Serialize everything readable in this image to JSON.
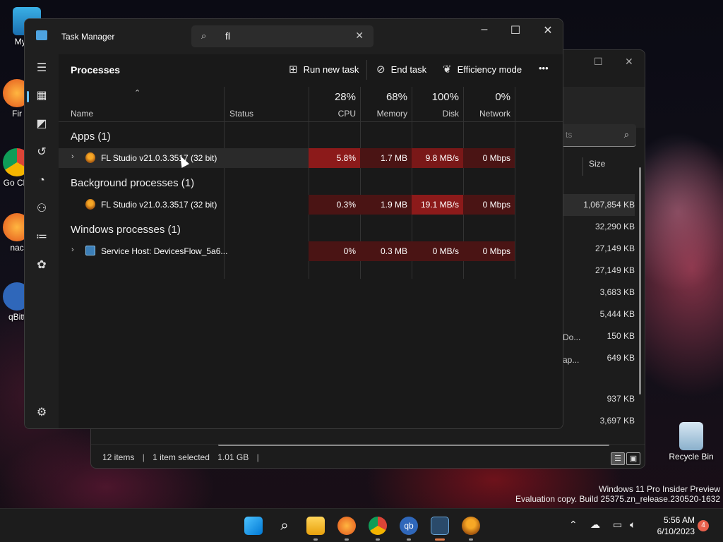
{
  "desktop": {
    "icons": [
      {
        "label": "My Co"
      },
      {
        "label": "Fir"
      },
      {
        "label": "Go Chr"
      },
      {
        "label": "nac"
      },
      {
        "label": "qBitt"
      },
      {
        "label": "Recycle Bin"
      }
    ]
  },
  "explorer": {
    "search_placeholder": "ts",
    "size_header": "Size",
    "sizes": [
      "1,067,854 KB",
      "32,290 KB",
      "27,149 KB",
      "27,149 KB",
      "3,683 KB",
      "5,444 KB",
      "150 KB",
      "649 KB",
      "",
      "937 KB",
      "3,697 KB"
    ],
    "fragments": [
      "Do...",
      "ap..."
    ],
    "status": {
      "items": "12 items",
      "selected": "1 item selected",
      "size": "1.01 GB"
    }
  },
  "task_manager": {
    "title": "Task Manager",
    "search_value": "fl",
    "page_heading": "Processes",
    "toolbar": {
      "run_new_task": "Run new task",
      "end_task": "End task",
      "efficiency_mode": "Efficiency mode",
      "more": "•••"
    },
    "columns": {
      "name": "Name",
      "status": "Status",
      "cpu": {
        "pct": "28%",
        "label": "CPU"
      },
      "memory": {
        "pct": "68%",
        "label": "Memory"
      },
      "disk": {
        "pct": "100%",
        "label": "Disk"
      },
      "network": {
        "pct": "0%",
        "label": "Network"
      }
    },
    "groups": [
      {
        "title": "Apps (1)",
        "rows": [
          {
            "name": "FL Studio v21.0.3.3517 (32 bit)",
            "cpu": "5.8%",
            "memory": "1.7 MB",
            "disk": "9.8 MB/s",
            "network": "0 Mbps",
            "expandable": true
          }
        ]
      },
      {
        "title": "Background processes (1)",
        "rows": [
          {
            "name": "FL Studio v21.0.3.3517 (32 bit)",
            "cpu": "0.3%",
            "memory": "1.9 MB",
            "disk": "19.1 MB/s",
            "network": "0 Mbps",
            "expandable": false
          }
        ]
      },
      {
        "title": "Windows processes (1)",
        "rows": [
          {
            "name": "Service Host: DevicesFlow_5a6...",
            "cpu": "0%",
            "memory": "0.3 MB",
            "disk": "0 MB/s",
            "network": "0 Mbps",
            "expandable": true
          }
        ]
      }
    ]
  },
  "watermark": {
    "line1": "Windows 11 Pro Insider Preview",
    "line2": "Evaluation copy. Build 25375.zn_release.230520-1632"
  },
  "taskbar": {
    "time": "5:56 AM",
    "date": "6/10/2023",
    "notification_count": "4"
  },
  "colors": {
    "cpu_heat_high": "#8c1a1a",
    "cpu_heat_low": "#4a1414",
    "accent": "#6cc4ff"
  }
}
